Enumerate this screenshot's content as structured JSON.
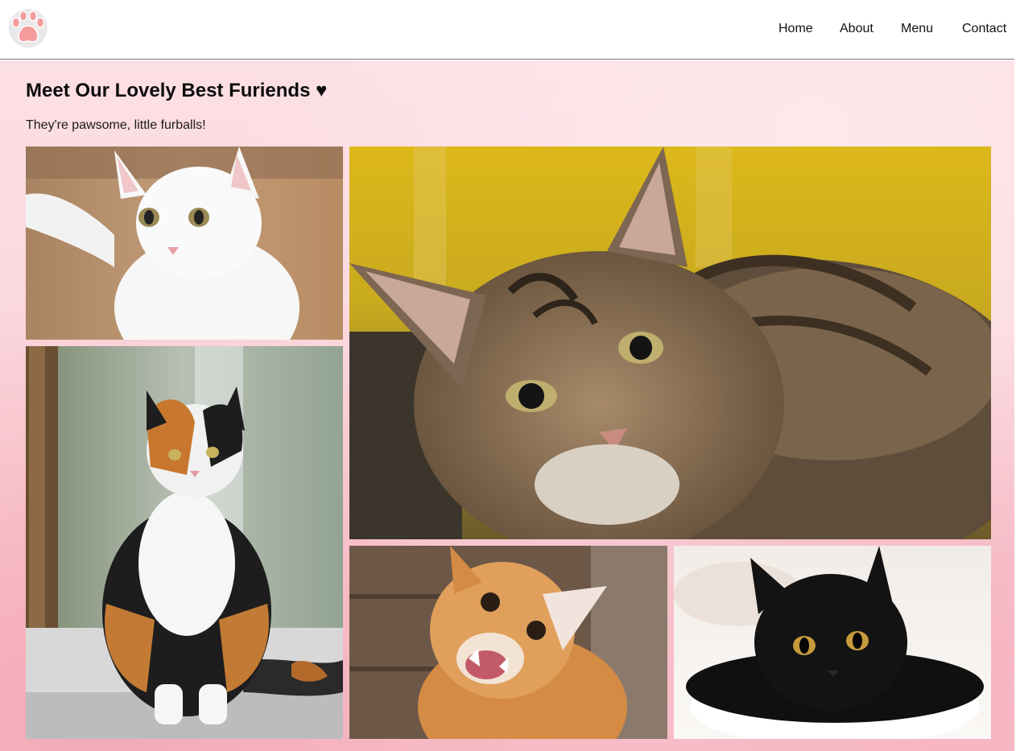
{
  "nav": {
    "logo_icon": "paw-icon",
    "items": [
      {
        "label": "Home"
      },
      {
        "label": "About"
      },
      {
        "label": "Menu"
      },
      {
        "label": "Contact"
      }
    ]
  },
  "main": {
    "title": "Meet Our Lovely Best Furiends ♥",
    "subtitle": "They're pawsome, little furballs!"
  },
  "gallery": [
    {
      "name": "white-cat-photo"
    },
    {
      "name": "calico-cat-photo"
    },
    {
      "name": "tabby-cat-photo"
    },
    {
      "name": "orange-cat-photo"
    },
    {
      "name": "black-cat-photo"
    }
  ],
  "colors": {
    "accent_pink": "#f7c4cd",
    "text": "#0d0d0d"
  }
}
